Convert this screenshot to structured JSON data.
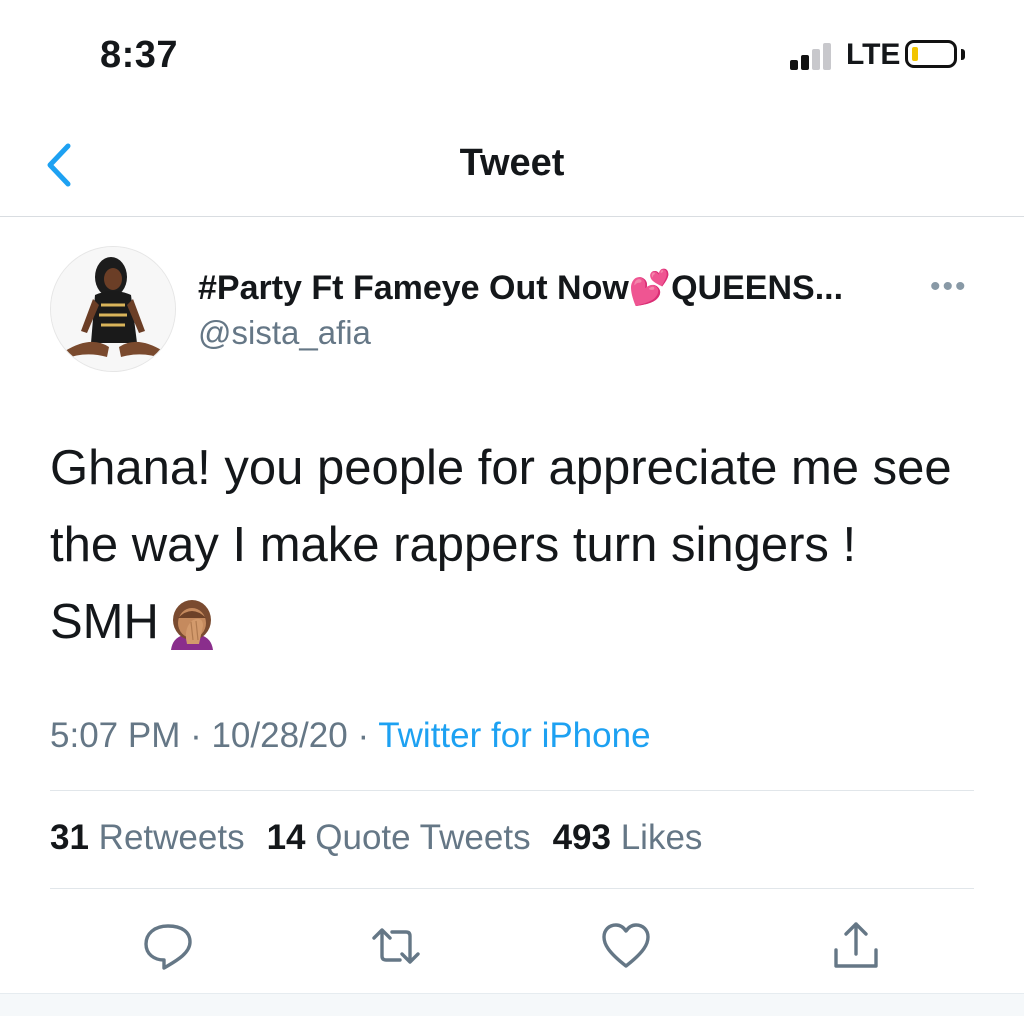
{
  "status_bar": {
    "time": "8:37",
    "network": "LTE",
    "battery_level": 0.15,
    "signal_bars_active": 2,
    "signal_bars_total": 4
  },
  "header": {
    "title": "Tweet",
    "back_icon": "chevron-left-icon"
  },
  "tweet": {
    "author": {
      "display_name": "#Party Ft Fameye Out Now💕QUEENS...",
      "handle": "@sista_afia"
    },
    "more_label": "•••",
    "text": "Ghana! you people for appreciate me see the way I make rappers turn singers ! SMH",
    "emoji_icon": "face-palm-icon",
    "time": "5:07 PM",
    "separator": " · ",
    "date": "10/28/20",
    "source": "Twitter for iPhone"
  },
  "stats": {
    "retweets_count": "31",
    "retweets_label": "Retweets",
    "quotes_count": "14",
    "quotes_label": "Quote Tweets",
    "likes_count": "493",
    "likes_label": "Likes"
  },
  "actions": [
    "reply-icon",
    "retweet-icon",
    "like-icon",
    "share-icon"
  ],
  "colors": {
    "accent": "#1da1f2",
    "secondary_text": "#657786",
    "primary_text": "#14171a",
    "divider": "#e1e6ea"
  }
}
